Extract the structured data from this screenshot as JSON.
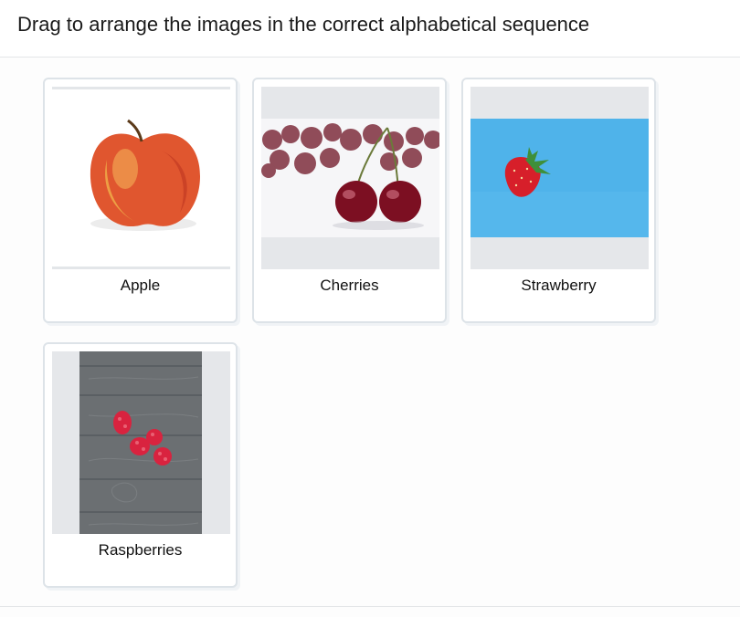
{
  "instruction": "Drag to arrange the images in the correct alphabetical sequence",
  "items": [
    {
      "label": "Apple",
      "image": "apple-photo"
    },
    {
      "label": "Cherries",
      "image": "cherries-photo"
    },
    {
      "label": "Strawberry",
      "image": "strawberry-photo"
    },
    {
      "label": "Raspberries",
      "image": "raspberries-photo"
    }
  ],
  "colors": {
    "card_border": "#dde3e8",
    "photo_frame": "#e7e9ec",
    "strawberry_bg": "#4fb3ea",
    "wood": "#6b6f72"
  }
}
